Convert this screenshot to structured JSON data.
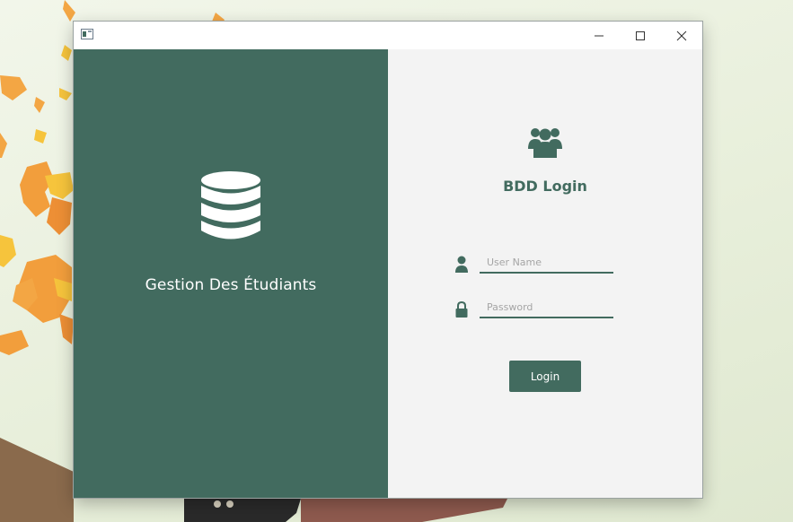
{
  "window": {
    "controls": {
      "minimize_icon": "minimize-icon",
      "maximize_icon": "maximize-icon",
      "close_icon": "close-icon"
    }
  },
  "left_panel": {
    "icon": "database-icon",
    "title": "Gestion Des Étudiants"
  },
  "right_panel": {
    "icon": "users-group-icon",
    "title": "BDD Login",
    "username": {
      "icon": "user-icon",
      "placeholder": "User Name",
      "value": ""
    },
    "password": {
      "icon": "lock-icon",
      "placeholder": "Password",
      "value": ""
    },
    "login_label": "Login"
  },
  "colors": {
    "accent": "#426b5f",
    "panel_bg": "#f3f3f3",
    "placeholder": "#a5a5a5"
  }
}
